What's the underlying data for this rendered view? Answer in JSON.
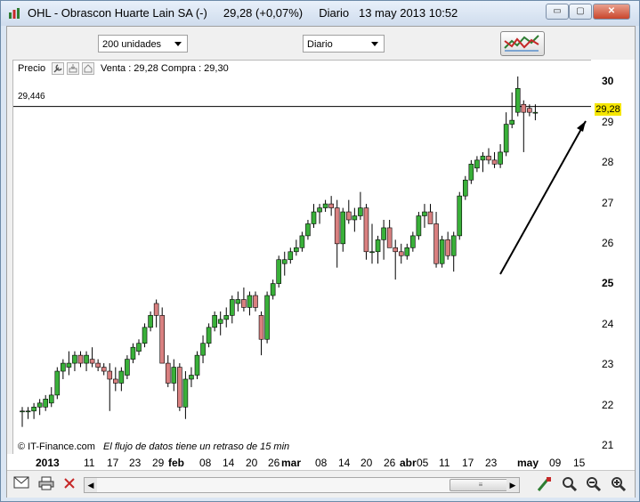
{
  "window": {
    "title": "OHL - Obrascon Huarte Lain SA (-)     29,28 (+0,07%)     Diario   13 may 2013 10:52",
    "minimize_label": "▭",
    "maximize_label": "▢",
    "close_label": "✕"
  },
  "toolbar": {
    "volume_select": "200 unidades",
    "period_select": "Diario",
    "indicator_icon": "indicator-chart-icon"
  },
  "chart_header": {
    "label": "Precio",
    "quote": "Venta : 29,28 Compra : 29,30",
    "hline_value": "29,446",
    "source": "© IT-Finance.com",
    "delay_note": "El flujo de datos tiene un retraso de 15 min"
  },
  "colors": {
    "up": "#39b039",
    "down": "#d98080",
    "current_price_bg": "#f5e600"
  },
  "price_axis": {
    "ticks": [
      "30",
      "29",
      "28",
      "27",
      "26",
      "25",
      "24",
      "23",
      "22",
      "21"
    ],
    "current": "29,28"
  },
  "date_axis": {
    "labels": [
      "2013",
      "11",
      "17",
      "23",
      "29",
      "feb",
      "08",
      "14",
      "20",
      "26",
      "mar",
      "08",
      "14",
      "20",
      "26",
      "abr",
      "05",
      "11",
      "17",
      "23",
      "may",
      "09",
      "15"
    ]
  },
  "chart_data": {
    "type": "candlestick",
    "ylim": [
      20.7,
      30.6
    ],
    "hline": 29.446,
    "current_price": 29.28,
    "candles": [
      [
        21.8,
        21.9,
        21.4,
        21.8
      ],
      [
        21.8,
        21.9,
        21.6,
        21.8
      ],
      [
        21.8,
        22.0,
        21.6,
        21.9
      ],
      [
        21.9,
        22.1,
        21.7,
        22.0
      ],
      [
        21.9,
        22.2,
        21.8,
        22.1
      ],
      [
        22.0,
        22.4,
        21.9,
        22.2
      ],
      [
        22.2,
        22.9,
        22.1,
        22.8
      ],
      [
        22.8,
        23.1,
        22.6,
        23.0
      ],
      [
        22.9,
        23.3,
        22.7,
        23.0
      ],
      [
        23.0,
        23.3,
        22.8,
        23.2
      ],
      [
        23.2,
        23.3,
        22.9,
        23.0
      ],
      [
        23.0,
        23.3,
        22.8,
        23.2
      ],
      [
        23.1,
        23.4,
        22.9,
        23.0
      ],
      [
        23.0,
        23.1,
        22.8,
        22.9
      ],
      [
        22.9,
        23.0,
        22.7,
        22.8
      ],
      [
        22.8,
        23.0,
        21.8,
        22.6
      ],
      [
        22.6,
        22.9,
        22.3,
        22.5
      ],
      [
        22.5,
        22.9,
        22.3,
        22.8
      ],
      [
        22.7,
        23.2,
        22.6,
        23.1
      ],
      [
        23.1,
        23.5,
        23.0,
        23.4
      ],
      [
        23.3,
        23.6,
        23.2,
        23.5
      ],
      [
        23.5,
        24.0,
        23.4,
        23.9
      ],
      [
        23.9,
        24.3,
        23.8,
        24.2
      ],
      [
        24.5,
        24.6,
        23.9,
        24.2
      ],
      [
        24.2,
        24.4,
        23.0,
        23.0
      ],
      [
        23.0,
        23.2,
        22.4,
        22.5
      ],
      [
        22.5,
        23.1,
        22.3,
        22.9
      ],
      [
        22.9,
        23.0,
        21.8,
        21.9
      ],
      [
        21.9,
        22.8,
        21.6,
        22.6
      ],
      [
        22.6,
        22.9,
        22.4,
        22.7
      ],
      [
        22.7,
        23.3,
        22.6,
        23.2
      ],
      [
        23.2,
        23.7,
        23.0,
        23.5
      ],
      [
        23.5,
        24.0,
        23.4,
        23.9
      ],
      [
        23.9,
        24.3,
        23.8,
        24.2
      ],
      [
        24.0,
        24.3,
        23.7,
        24.1
      ],
      [
        24.1,
        24.4,
        23.9,
        24.2
      ],
      [
        24.2,
        24.7,
        24.0,
        24.6
      ],
      [
        24.5,
        24.8,
        24.3,
        24.6
      ],
      [
        24.6,
        24.9,
        24.3,
        24.4
      ],
      [
        24.4,
        24.8,
        24.2,
        24.7
      ],
      [
        24.7,
        24.8,
        24.3,
        24.4
      ],
      [
        24.2,
        24.3,
        23.2,
        23.6
      ],
      [
        23.6,
        24.8,
        23.5,
        24.7
      ],
      [
        24.7,
        25.1,
        24.6,
        25.0
      ],
      [
        25.0,
        25.7,
        24.9,
        25.6
      ],
      [
        25.5,
        25.8,
        25.2,
        25.6
      ],
      [
        25.6,
        25.9,
        25.5,
        25.8
      ],
      [
        25.8,
        26.1,
        25.7,
        25.9
      ],
      [
        25.9,
        26.3,
        25.8,
        26.2
      ],
      [
        26.2,
        26.6,
        26.1,
        26.5
      ],
      [
        26.5,
        27.0,
        26.4,
        26.8
      ],
      [
        26.8,
        27.0,
        26.5,
        26.9
      ],
      [
        26.9,
        27.1,
        26.8,
        27.0
      ],
      [
        27.0,
        27.2,
        26.7,
        26.9
      ],
      [
        26.9,
        27.1,
        25.4,
        26.0
      ],
      [
        26.0,
        26.9,
        25.8,
        26.8
      ],
      [
        26.8,
        27.1,
        26.5,
        26.6
      ],
      [
        26.6,
        26.9,
        26.3,
        26.7
      ],
      [
        26.7,
        27.3,
        26.6,
        26.9
      ],
      [
        26.9,
        27.0,
        25.6,
        25.8
      ],
      [
        25.8,
        26.5,
        25.5,
        25.8
      ],
      [
        25.8,
        26.2,
        25.5,
        26.1
      ],
      [
        26.1,
        26.6,
        25.6,
        26.4
      ],
      [
        26.4,
        26.6,
        26.0,
        25.9
      ],
      [
        25.9,
        26.1,
        25.1,
        25.8
      ],
      [
        25.8,
        26.0,
        25.5,
        25.7
      ],
      [
        25.7,
        26.0,
        25.6,
        25.9
      ],
      [
        25.9,
        26.3,
        25.8,
        26.2
      ],
      [
        26.2,
        26.8,
        26.1,
        26.7
      ],
      [
        26.7,
        27.0,
        26.4,
        26.8
      ],
      [
        26.8,
        27.0,
        26.5,
        26.5
      ],
      [
        26.5,
        26.8,
        25.4,
        25.5
      ],
      [
        25.5,
        26.2,
        25.4,
        26.1
      ],
      [
        26.1,
        26.3,
        25.6,
        25.7
      ],
      [
        25.7,
        26.3,
        25.3,
        26.2
      ],
      [
        26.2,
        27.3,
        26.1,
        27.2
      ],
      [
        27.2,
        27.7,
        27.1,
        27.6
      ],
      [
        27.6,
        28.1,
        27.5,
        28.0
      ],
      [
        27.9,
        28.2,
        27.8,
        28.1
      ],
      [
        28.1,
        28.3,
        27.8,
        28.2
      ],
      [
        28.2,
        28.4,
        28.0,
        28.1
      ],
      [
        28.1,
        28.3,
        27.9,
        28.0
      ],
      [
        28.0,
        28.5,
        27.9,
        28.3
      ],
      [
        28.3,
        29.3,
        28.2,
        29.0
      ],
      [
        29.0,
        29.8,
        28.9,
        29.1
      ],
      [
        29.3,
        30.2,
        29.2,
        29.9
      ],
      [
        29.5,
        29.6,
        28.3,
        29.3
      ],
      [
        29.4,
        29.5,
        29.2,
        29.3
      ],
      [
        29.3,
        29.5,
        29.1,
        29.3
      ]
    ]
  },
  "bottom": {
    "icons": [
      "mail-icon",
      "print-icon",
      "disconnect-icon",
      "scroll-left-icon",
      "scroll-right-icon",
      "draw-tools-icon",
      "zoom-fit-icon",
      "zoom-out-icon",
      "zoom-in-icon"
    ]
  }
}
